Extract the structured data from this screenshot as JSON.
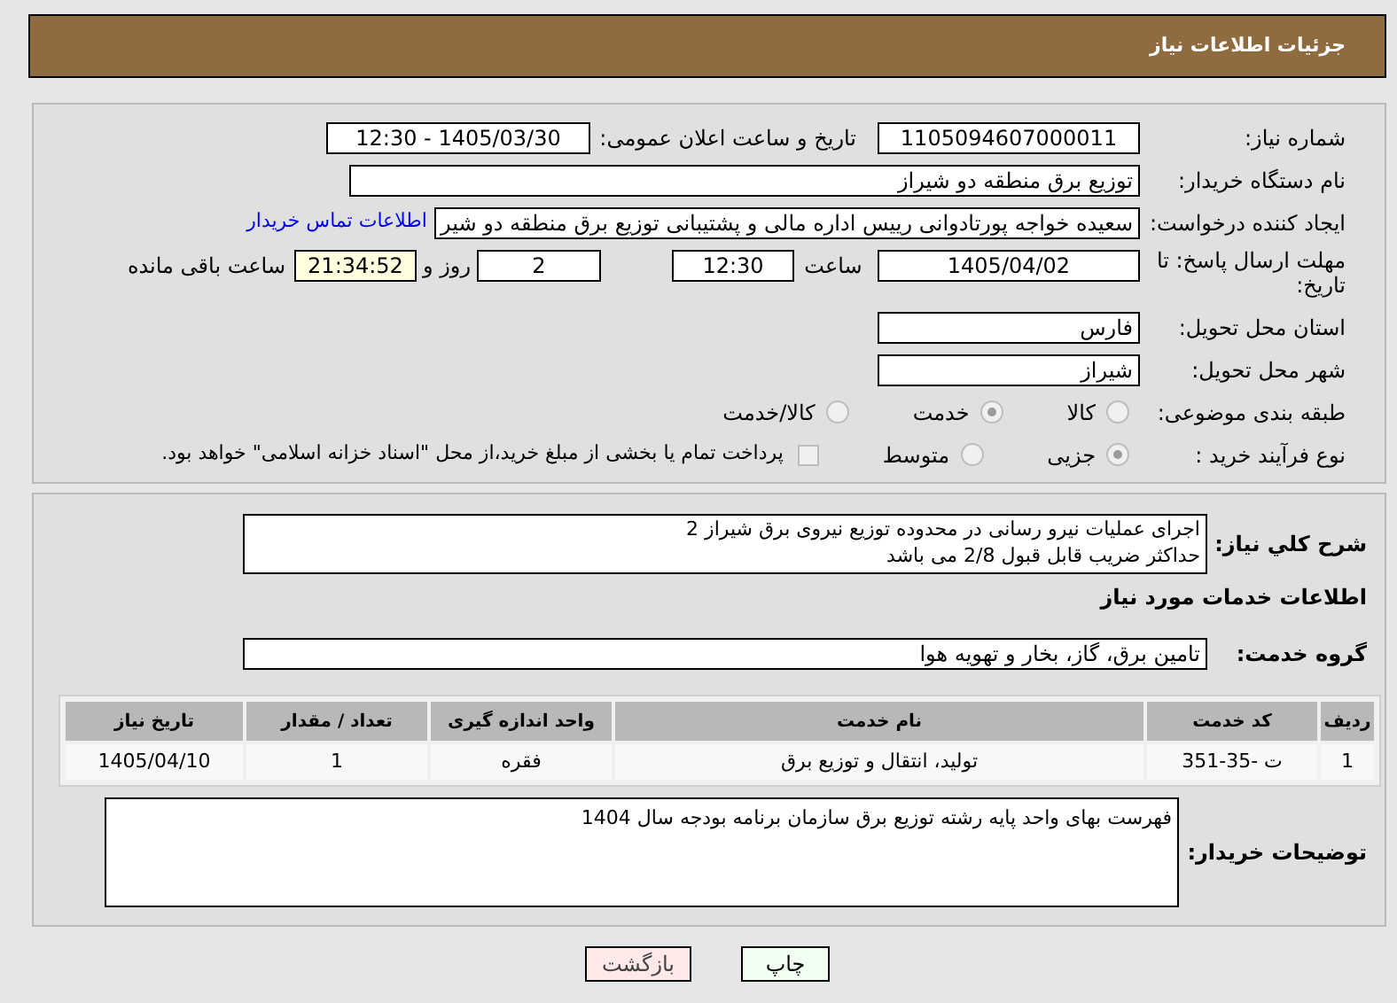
{
  "header": {
    "title": "جزئیات اطلاعات نیاز"
  },
  "need_number": {
    "label": "شماره نیاز:",
    "value": "1105094607000011"
  },
  "announce": {
    "label": "تاریخ و ساعت اعلان عمومی:",
    "value": "1405/03/30 - 12:30"
  },
  "buyer_org": {
    "label": "نام دستگاه خریدار:",
    "value": "توزیع برق منطقه دو شیراز"
  },
  "requester": {
    "label": "ایجاد کننده درخواست:",
    "value": "سعیده خواجه پورتادوانی رییس اداره مالی و پشتیبانی  توزیع برق منطقه دو شیر",
    "link": "اطلاعات تماس خریدار"
  },
  "deadline": {
    "label": "مهلت ارسال پاسخ: تا تاریخ:",
    "date": "1405/04/02",
    "time_label": "ساعت",
    "time": "12:30",
    "days": "2",
    "days_label": "روز و",
    "remaining": "21:34:52",
    "remaining_label": "ساعت باقی مانده"
  },
  "province": {
    "label": "استان محل تحویل:",
    "value": "فارس"
  },
  "city": {
    "label": "شهر محل تحویل:",
    "value": "شیراز"
  },
  "category": {
    "label": "طبقه بندی موضوعی:",
    "options": [
      {
        "label": "کالا",
        "selected": false
      },
      {
        "label": "خدمت",
        "selected": true
      },
      {
        "label": "کالا/خدمت",
        "selected": false
      }
    ]
  },
  "process": {
    "label": "نوع فرآیند خرید :",
    "options": [
      {
        "label": "جزیی",
        "selected": true
      },
      {
        "label": "متوسط",
        "selected": false
      }
    ],
    "payment": {
      "checked": false,
      "label": "پرداخت تمام یا بخشی از مبلغ خرید،از محل \"اسناد خزانه اسلامی\" خواهد بود."
    }
  },
  "description": {
    "label": "شرح كلي نياز:",
    "lines": [
      "اجرای عملیات نیرو رسانی در محدوده توزیع نیروی برق شیراز 2",
      "حداکثر ضریب قابل قبول 2/8 می باشد"
    ]
  },
  "services_heading": "اطلاعات خدمات مورد نیاز",
  "service_group": {
    "label": "گروه خدمت:",
    "value": "تامین برق، گاز، بخار و تهویه هوا"
  },
  "table": {
    "columns": [
      "ردیف",
      "کد خدمت",
      "نام خدمت",
      "واحد اندازه گیری",
      "تعداد / مقدار",
      "تاریخ نیاز"
    ],
    "rows": [
      [
        "1",
        "ت -35-351",
        "تولید، انتقال و توزیع برق",
        "فقره",
        "1",
        "1405/04/10"
      ]
    ]
  },
  "buyer_notes": {
    "label": "توضیحات خریدار:",
    "value": "فهرست بهای واحد پایه رشته توزیع  برق سازمان برنامه بودجه سال 1404"
  },
  "buttons": [
    {
      "label": "چاپ",
      "kind": "print"
    },
    {
      "label": "بازگشت",
      "kind": "back"
    }
  ]
}
